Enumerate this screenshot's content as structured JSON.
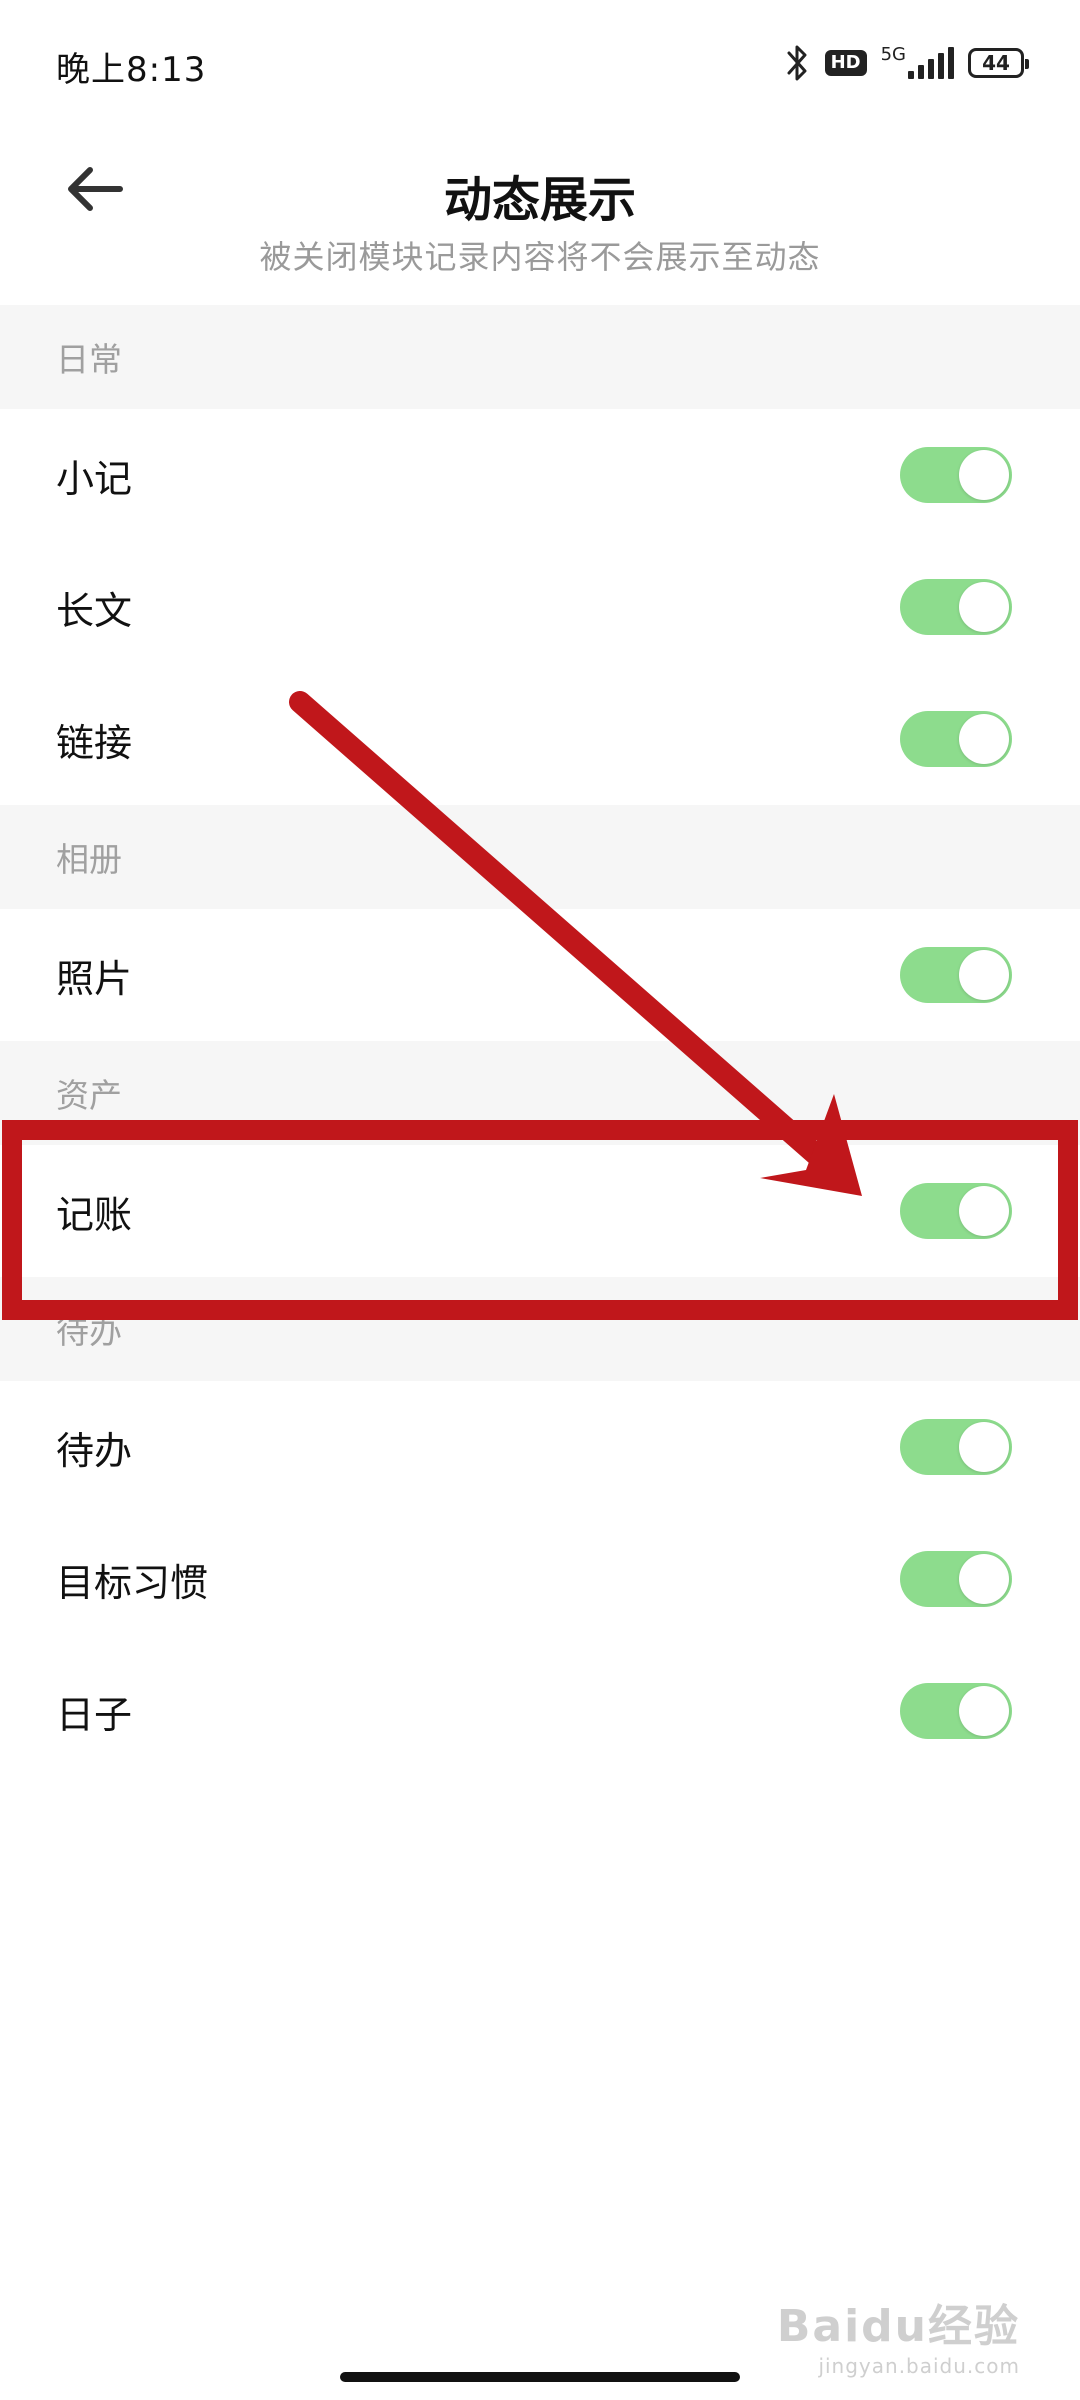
{
  "status_bar": {
    "time": "晚上8:13",
    "hd": "HD",
    "network": "5G",
    "battery": "44"
  },
  "header": {
    "title": "动态展示",
    "subtitle": "被关闭模块记录内容将不会展示至动态"
  },
  "sections": [
    {
      "title": "日常",
      "items": [
        {
          "label": "小记",
          "on": true
        },
        {
          "label": "长文",
          "on": true
        },
        {
          "label": "链接",
          "on": true
        }
      ]
    },
    {
      "title": "相册",
      "items": [
        {
          "label": "照片",
          "on": true
        }
      ]
    },
    {
      "title": "资产",
      "items": [
        {
          "label": "记账",
          "on": true
        }
      ]
    },
    {
      "title": "待办",
      "items": [
        {
          "label": "待办",
          "on": true
        },
        {
          "label": "目标习惯",
          "on": true
        },
        {
          "label": "日子",
          "on": true
        }
      ]
    }
  ],
  "colors": {
    "toggle_on": "#8ddc8d",
    "annotation": "#c0171b"
  },
  "watermark": {
    "main": "Baidu经验",
    "sub": "jingyan.baidu.com"
  }
}
